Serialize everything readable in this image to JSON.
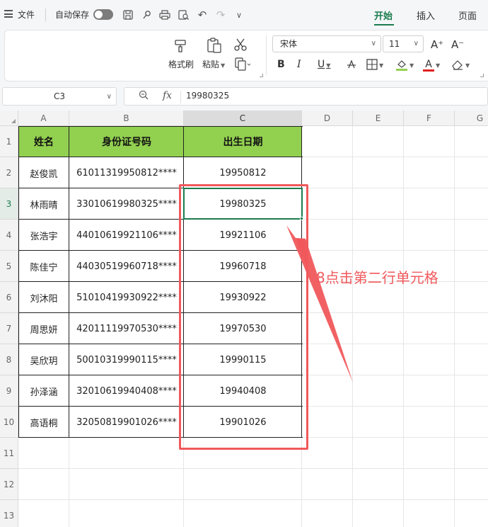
{
  "menu": {
    "file_label": "文件",
    "autosave_label": "自动保存"
  },
  "tabs": [
    {
      "label": "开始",
      "active": true
    },
    {
      "label": "插入",
      "active": false
    },
    {
      "label": "页面",
      "active": false
    }
  ],
  "ribbon": {
    "format_painter_label": "格式刷",
    "paste_label": "粘贴",
    "font_name": "宋体",
    "font_size": "11",
    "bold": "B",
    "italic": "I",
    "underline": "U",
    "font_grow": "A⁺",
    "font_shrink": "A⁻",
    "font_color_letter": "A"
  },
  "formula_bar": {
    "cell_ref": "C3",
    "fx_label": "fx",
    "value": "19980325"
  },
  "columns": [
    "A",
    "B",
    "C",
    "D",
    "E",
    "F",
    "G"
  ],
  "rows": [
    "1",
    "2",
    "3",
    "4",
    "5",
    "6",
    "7",
    "8",
    "9",
    "10",
    "11",
    "12",
    "13"
  ],
  "selected_column": "C",
  "selected_row": "3",
  "table": {
    "headers": [
      "姓名",
      "身份证号码",
      "出生日期"
    ],
    "rows": [
      [
        "赵俊凯",
        "61011319950812****",
        "19950812"
      ],
      [
        "林雨晴",
        "33010619980325****",
        "19980325"
      ],
      [
        "张浩宇",
        "44010619921106****",
        "19921106"
      ],
      [
        "陈佳宁",
        "44030519960718****",
        "19960718"
      ],
      [
        "刘沐阳",
        "51010419930922****",
        "19930922"
      ],
      [
        "周思妍",
        "42011119970530****",
        "19970530"
      ],
      [
        "吴欣玥",
        "50010319990115****",
        "19990115"
      ],
      [
        "孙泽涵",
        "32010619940408****",
        "19940408"
      ],
      [
        "高语桐",
        "32050819901026****",
        "19901026"
      ]
    ]
  },
  "colors": {
    "accent": "#1a7c4e",
    "header_fill": "#92d050",
    "annotation": "#f0595c"
  },
  "annotation": {
    "text": "8点击第二行单元格"
  }
}
